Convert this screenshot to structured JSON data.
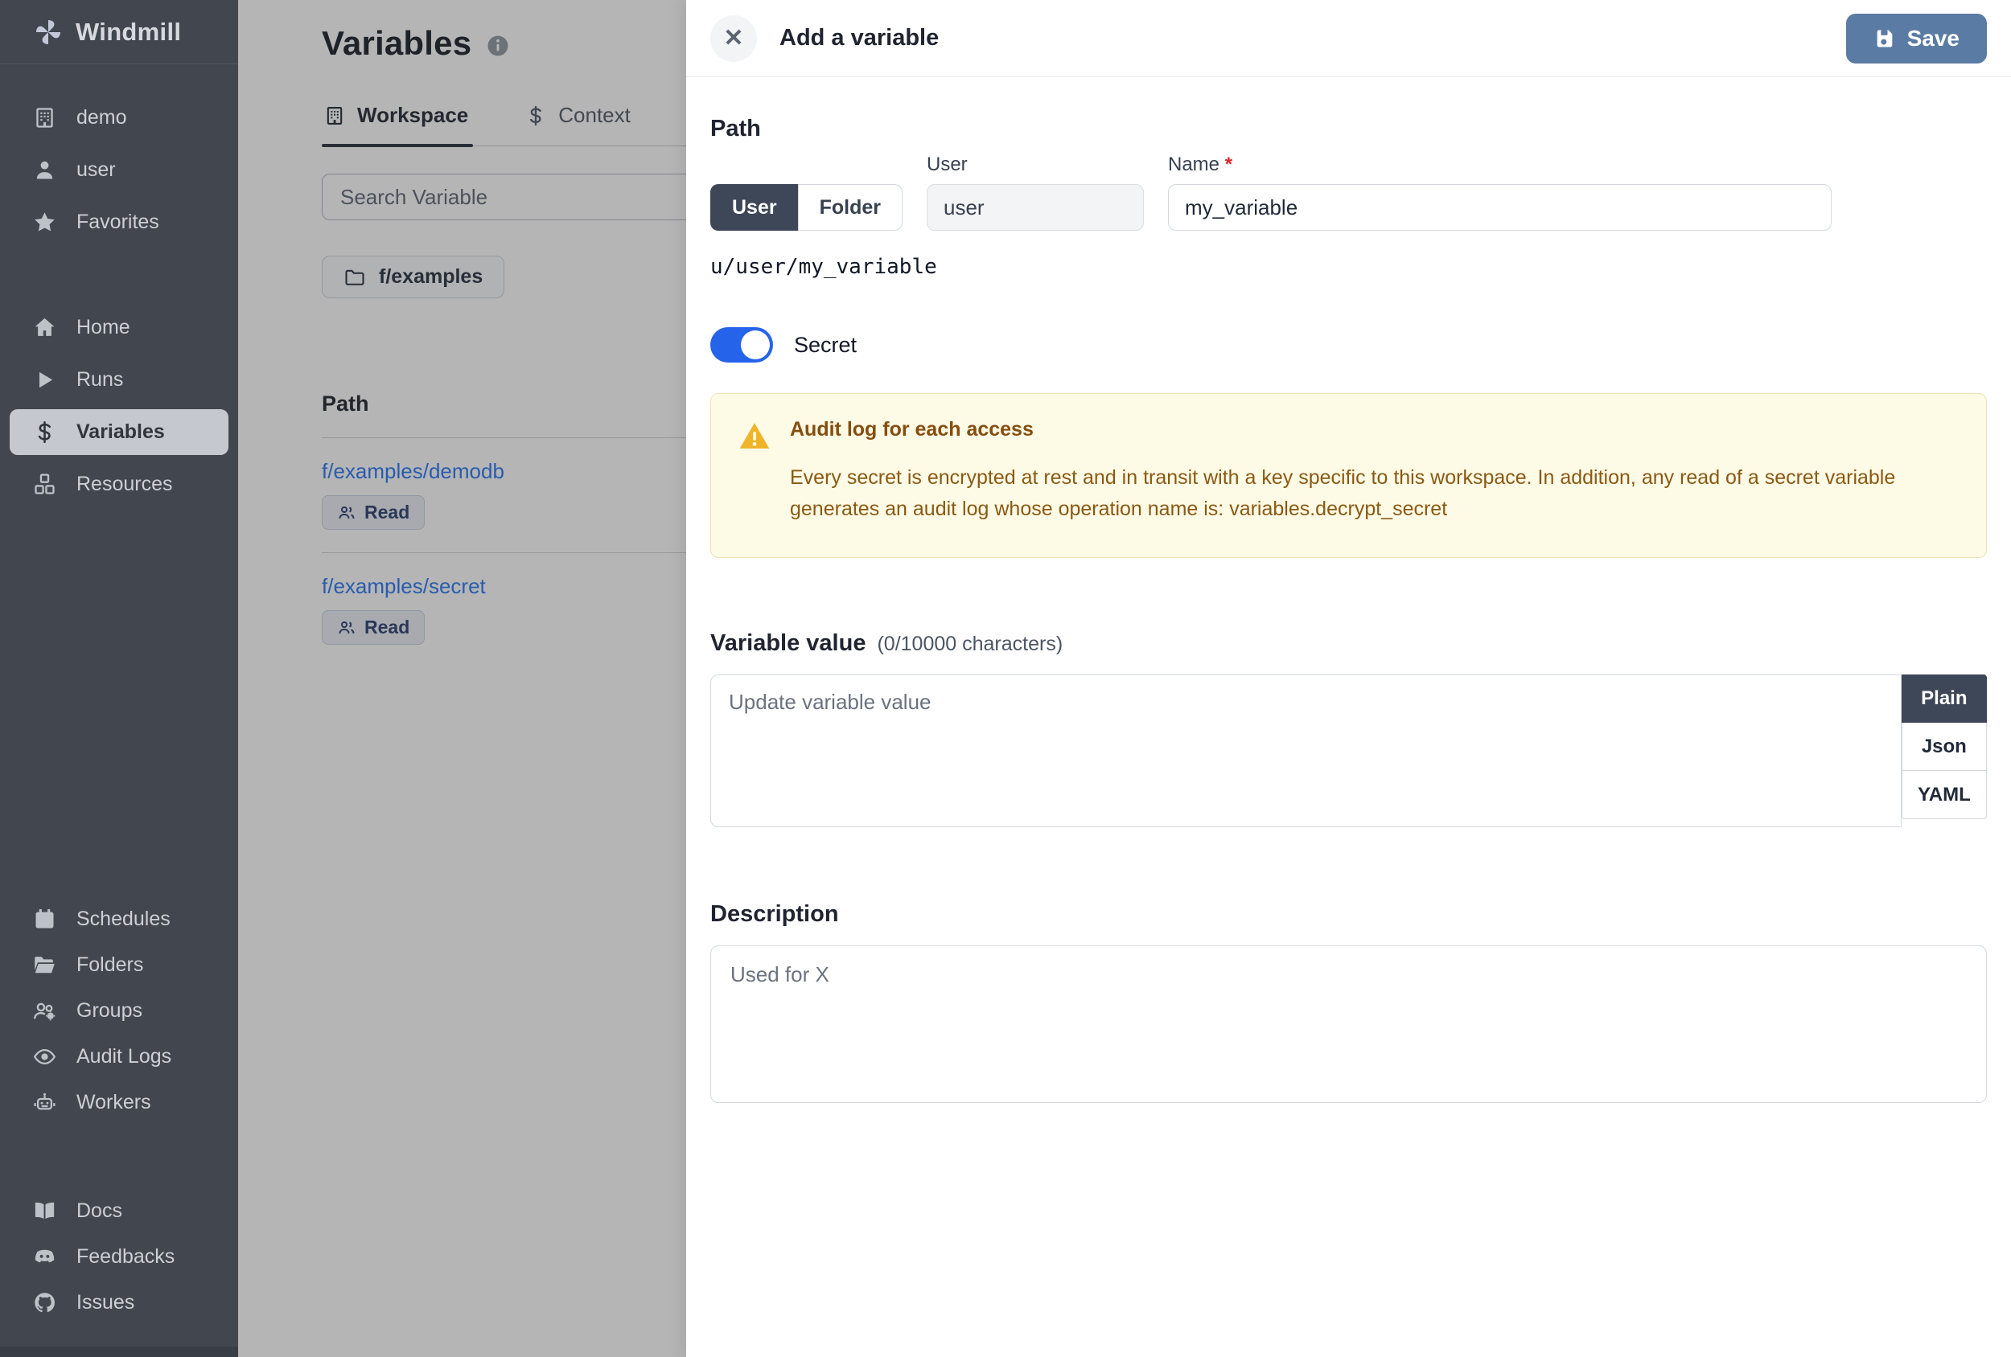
{
  "sidebar": {
    "logo": "Windmill",
    "workspace_items": [
      {
        "label": "demo"
      },
      {
        "label": "user"
      },
      {
        "label": "Favorites"
      }
    ],
    "nav_items": [
      {
        "label": "Home"
      },
      {
        "label": "Runs"
      },
      {
        "label": "Variables",
        "active": true
      },
      {
        "label": "Resources"
      }
    ],
    "admin_items": [
      {
        "label": "Schedules"
      },
      {
        "label": "Folders"
      },
      {
        "label": "Groups"
      },
      {
        "label": "Audit Logs"
      },
      {
        "label": "Workers"
      }
    ],
    "meta_items": [
      {
        "label": "Docs"
      },
      {
        "label": "Feedbacks"
      },
      {
        "label": "Issues"
      }
    ]
  },
  "main": {
    "title": "Variables",
    "tabs": [
      {
        "label": "Workspace",
        "active": true
      },
      {
        "label": "Context"
      }
    ],
    "search_placeholder": "Search Variable",
    "folder_chip": "f/examples",
    "table": {
      "path_header": "Path",
      "rows": [
        {
          "path": "f/examples/demodb",
          "badge": "Read"
        },
        {
          "path": "f/examples/secret",
          "badge": "Read"
        }
      ]
    }
  },
  "drawer": {
    "title": "Add a variable",
    "save_label": "Save",
    "path_section": {
      "heading": "Path",
      "owner_toggle": {
        "user": "User",
        "folder": "Folder",
        "selected": "User"
      },
      "user_label": "User",
      "user_value": "user",
      "name_label": "Name",
      "name_required_mark": "*",
      "name_value": "my_variable",
      "full_path": "u/user/my_variable"
    },
    "secret_toggle": {
      "label": "Secret",
      "on": true
    },
    "warning": {
      "title": "Audit log for each access",
      "body": "Every secret is encrypted at rest and in transit with a key specific to this workspace. In addition, any read of a secret variable generates an audit log whose operation name is: variables.decrypt_secret"
    },
    "value_section": {
      "heading": "Variable value",
      "counter": "(0/10000 characters)",
      "placeholder": "Update variable value",
      "format_tabs": [
        {
          "label": "Plain",
          "active": true
        },
        {
          "label": "Json"
        },
        {
          "label": "YAML"
        }
      ]
    },
    "description_section": {
      "heading": "Description",
      "placeholder": "Used for X"
    }
  },
  "colors": {
    "sidebar_bg": "#42474f",
    "accent_blue": "#2563eb",
    "save_button": "#5a7ba3",
    "link_blue": "#3b82f6",
    "warning_bg": "#fdfae6",
    "warning_text": "#854d0e",
    "active_segment": "#3e4757"
  }
}
